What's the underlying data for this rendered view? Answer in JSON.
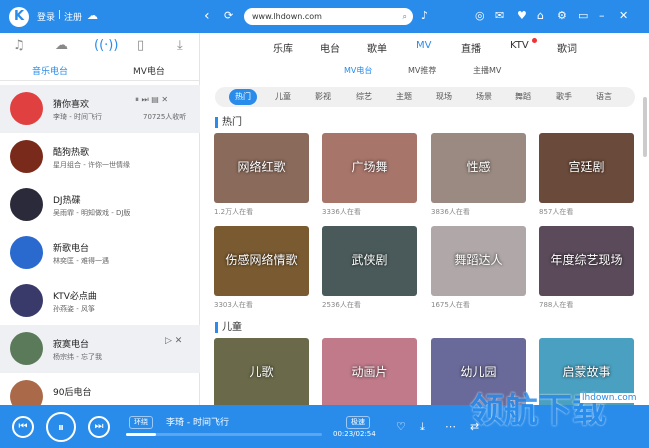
{
  "top": {
    "login": "登录",
    "register": "注册",
    "url": "www.lhdown.com"
  },
  "left": {
    "tabs": [
      "音乐电台",
      "MV电台"
    ],
    "items": [
      {
        "name": "猜你喜欢",
        "sub": "李琦 - 时间飞行",
        "extra": "70725人收听"
      },
      {
        "name": "酷狗热歌",
        "sub": "星月组合 - 许你一世情缘"
      },
      {
        "name": "DJ热碟",
        "sub": "吴雨霏 - 明知做戏 - DJ版"
      },
      {
        "name": "新歌电台",
        "sub": "林奕匡 - 难得一遇"
      },
      {
        "name": "KTV必点曲",
        "sub": "孙燕姿 - 风筝"
      },
      {
        "name": "寂寞电台",
        "sub": "杨宗纬 - 忘了我"
      },
      {
        "name": "90后电台",
        "sub": ""
      }
    ]
  },
  "nav": [
    "乐库",
    "电台",
    "歌单",
    "MV",
    "直播",
    "KTV",
    "歌词"
  ],
  "subnav": [
    "MV电台",
    "MV推荐",
    "主播MV"
  ],
  "cats": [
    "热门",
    "儿童",
    "影视",
    "综艺",
    "主题",
    "现场",
    "场景",
    "舞蹈",
    "歌手",
    "语言"
  ],
  "sections": [
    "热门",
    "儿童"
  ],
  "cards": [
    {
      "title": "网络红歌",
      "count": "1.2万人在看",
      "color": "#8a6a5a"
    },
    {
      "title": "广场舞",
      "count": "3336人在看",
      "color": "#a7756a"
    },
    {
      "title": "性感",
      "count": "3836人在看",
      "color": "#9a8a82"
    },
    {
      "title": "宫廷剧",
      "count": "857人在看",
      "color": "#6a4a3a"
    },
    {
      "title": "伤感网络情歌",
      "count": "3303人在看",
      "color": "#7a5a30"
    },
    {
      "title": "武侠剧",
      "count": "2536人在看",
      "color": "#4a5a5a"
    },
    {
      "title": "舞蹈达人",
      "count": "1675人在看",
      "color": "#b0a8a8"
    },
    {
      "title": "年度综艺现场",
      "count": "788人在看",
      "color": "#5a4a5a"
    },
    {
      "title": "儿歌",
      "count": "",
      "color": "#6a6a4a"
    },
    {
      "title": "动画片",
      "count": "",
      "color": "#c07a8a"
    },
    {
      "title": "幼儿园",
      "count": "",
      "color": "#6a6a9a"
    },
    {
      "title": "启蒙故事",
      "count": "",
      "color": "#4aa0c0"
    }
  ],
  "player": {
    "mode": "环绕",
    "song": "李琦 - 时间飞行",
    "quality": "极速",
    "time": "00:23/02:54"
  },
  "watermark": {
    "text": "领航下载",
    "url": "lhdown.com"
  }
}
